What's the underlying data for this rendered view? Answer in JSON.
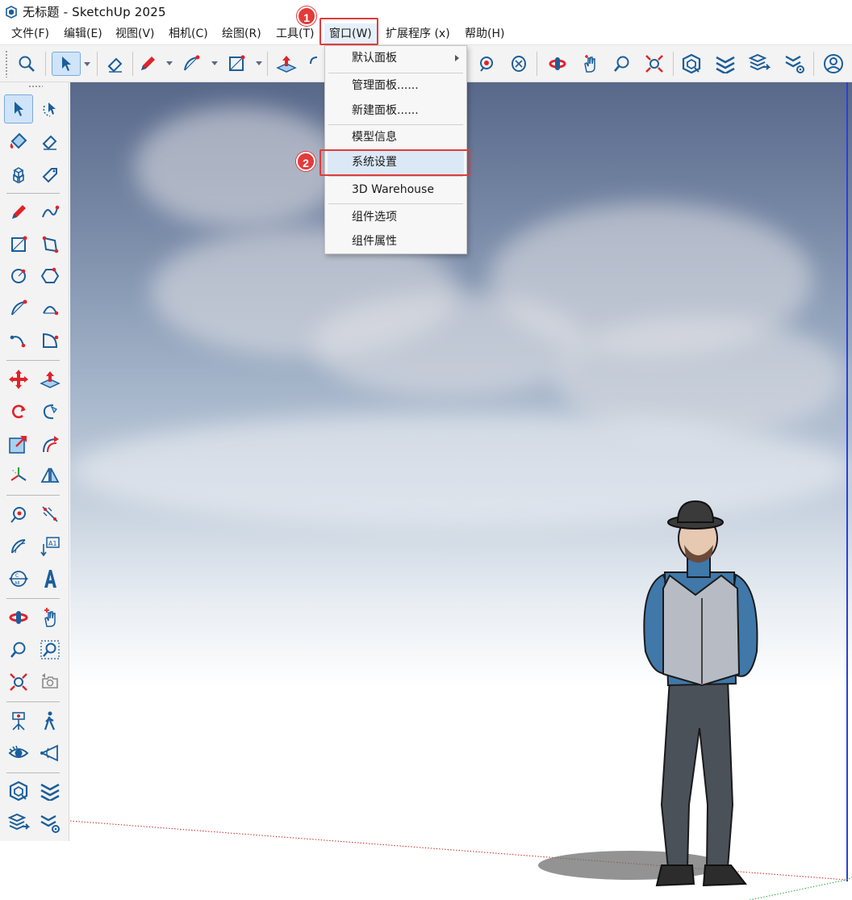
{
  "window": {
    "title": "无标题 - SketchUp 2025",
    "logo_icon": "sketchup-logo-icon"
  },
  "menubar": {
    "items": [
      {
        "label": "文件(F)"
      },
      {
        "label": "编辑(E)"
      },
      {
        "label": "视图(V)"
      },
      {
        "label": "相机(C)"
      },
      {
        "label": "绘图(R)"
      },
      {
        "label": "工具(T)"
      },
      {
        "label": "窗口(W)"
      },
      {
        "label": "扩展程序 (x)"
      },
      {
        "label": "帮助(H)"
      }
    ],
    "active_item": "窗口(W)"
  },
  "window_menu": {
    "items": [
      {
        "label": "默认面板",
        "has_submenu": true
      },
      {
        "label": "管理面板......"
      },
      {
        "label": "新建面板......"
      },
      {
        "label": "模型信息"
      },
      {
        "label": "系统设置",
        "highlighted": true
      },
      {
        "label": "3D Warehouse"
      },
      {
        "label": "组件选项"
      },
      {
        "label": "组件属性"
      }
    ]
  },
  "annotations": {
    "step1": "1",
    "step2": "2",
    "highlight_color": "#e23b3b"
  },
  "toolbar": {
    "icons": [
      "search-icon",
      "select-icon",
      "eraser-icon",
      "pencil-icon",
      "arc-icon",
      "rectangle-icon",
      "push-pull-icon",
      "move-icon",
      "paint-icon",
      "orbit-icon",
      "pan-icon",
      "zoom-icon",
      "zoom-extents-icon",
      "3d-warehouse-icon",
      "extension-warehouse-icon",
      "layer-export-icon",
      "extension-manager-icon",
      "account-icon"
    ]
  },
  "left_toolbar": {
    "icons": [
      "select-icon",
      "lasso-select-icon",
      "paint-bucket-icon",
      "eraser-icon",
      "component-icon",
      "tag-icon",
      "pencil-icon",
      "freehand-icon",
      "rectangle-icon",
      "rotated-rectangle-icon",
      "circle-icon",
      "polygon-icon",
      "arc-icon",
      "two-point-arc-icon",
      "three-point-arc-icon",
      "pie-icon",
      "move-icon",
      "push-pull-icon",
      "rotate-icon",
      "follow-me-icon",
      "scale-icon",
      "offset-icon",
      "axes-icon",
      "flip-icon",
      "tape-measure-icon",
      "dimension-icon",
      "protractor-icon",
      "text-icon",
      "section-plane-icon",
      "3d-text-icon",
      "orbit-icon",
      "pan-icon",
      "zoom-icon",
      "zoom-window-icon",
      "zoom-extents-icon",
      "previous-view-icon",
      "position-camera-icon",
      "walk-icon",
      "look-around-icon",
      "field-of-view-icon",
      "3d-warehouse-icon",
      "extension-warehouse-icon",
      "layer-export-icon",
      "extension-manager-icon"
    ]
  },
  "colors": {
    "accent_blue": "#1b5e9b",
    "accent_red": "#e0232a",
    "sky_top": "#58688a",
    "menu_highlight": "#dbe9f7"
  }
}
